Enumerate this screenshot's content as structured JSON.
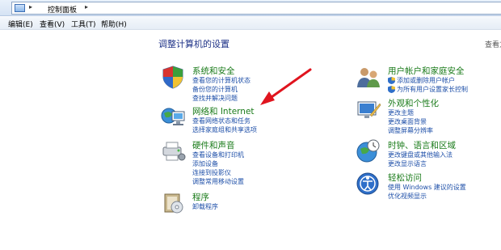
{
  "addressbar": {
    "breadcrumb": "控制面板"
  },
  "menubar": {
    "items": [
      "编辑(E)",
      "查看(V)",
      "工具(T)",
      "帮助(H)"
    ]
  },
  "main": {
    "title": "调整计算机的设置",
    "view_by": "查看方"
  },
  "categories": {
    "system": {
      "title": "系统和安全",
      "links": [
        "查看您的计算机状态",
        "备份您的计算机",
        "查找并解决问题"
      ]
    },
    "network": {
      "title": "网络和 Internet",
      "links": [
        "查看网络状态和任务",
        "选择家庭组和共享选项"
      ]
    },
    "hardware": {
      "title": "硬件和声音",
      "links": [
        "查看设备和打印机",
        "添加设备",
        "连接到投影仪",
        "调整常用移动设置"
      ]
    },
    "programs": {
      "title": "程序",
      "links": [
        "卸载程序"
      ]
    },
    "users": {
      "title": "用户帐户和家庭安全",
      "links": [
        "添加或删除用户帐户",
        "为所有用户设置家长控制"
      ]
    },
    "appearance": {
      "title": "外观和个性化",
      "links": [
        "更改主题",
        "更改桌面背景",
        "调整屏幕分辨率"
      ]
    },
    "clock": {
      "title": "时钟、语言和区域",
      "links": [
        "更改键盘或其他输入法",
        "更改显示语言"
      ]
    },
    "ease": {
      "title": "轻松访问",
      "links": [
        "使用 Windows 建议的设置",
        "优化视频显示"
      ]
    }
  },
  "colors": {
    "category_title": "#1a7b1a",
    "link": "#1e4fa8",
    "annotation_arrow": "#e0141e"
  }
}
